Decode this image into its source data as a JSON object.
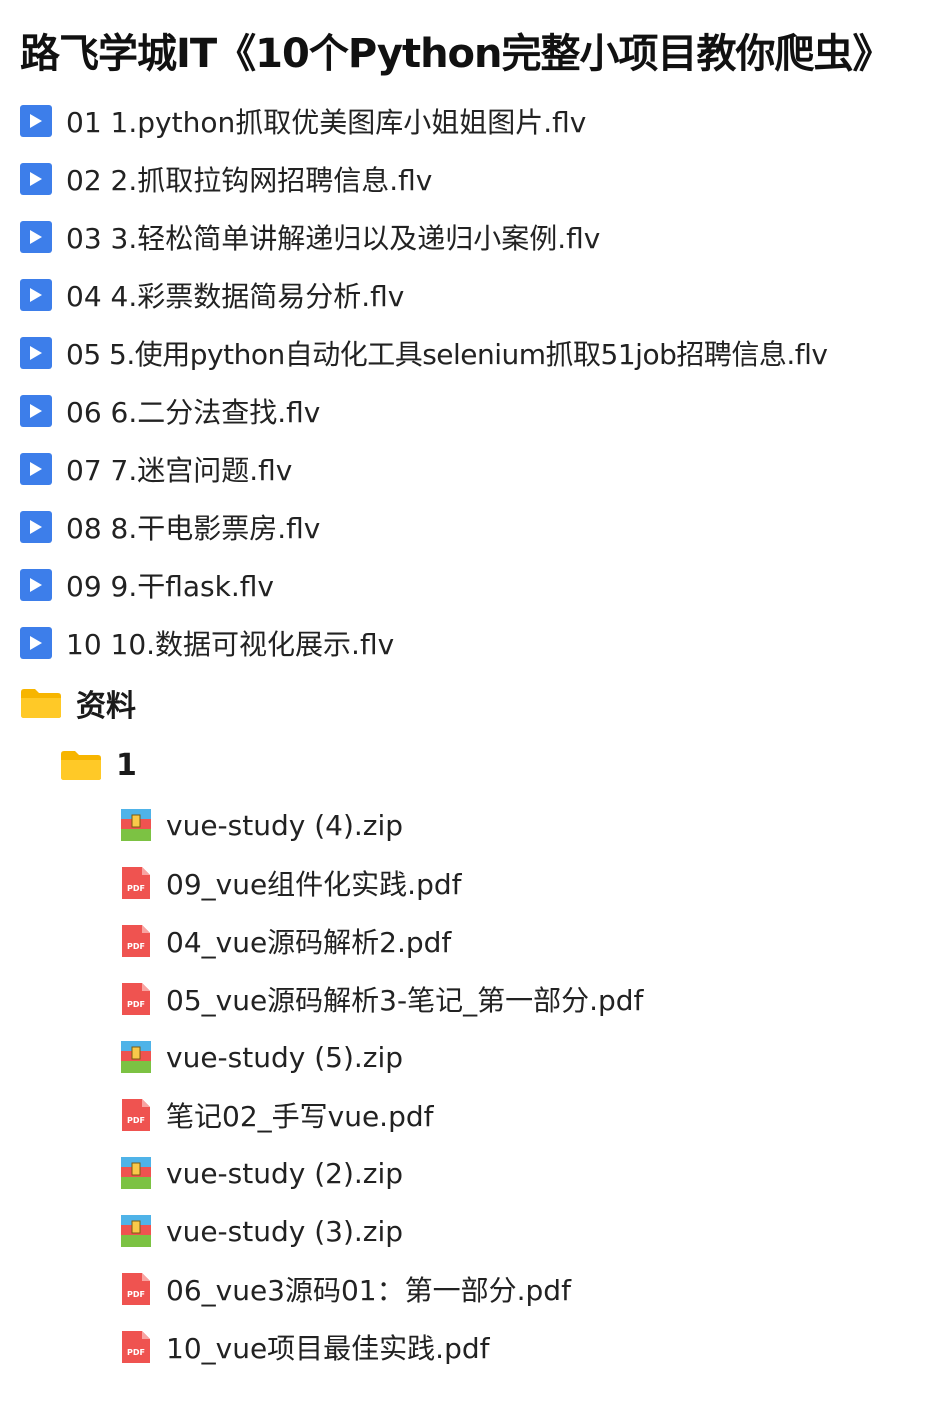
{
  "title": "路飞学城IT《10个Python完整小项目教你爬虫》",
  "videos": [
    {
      "label": "01 1.python抓取优美图库小姐姐图片.flv",
      "icon": "play-icon"
    },
    {
      "label": "02 2.抓取拉钩网招聘信息.flv",
      "icon": "play-icon"
    },
    {
      "label": "03 3.轻松简单讲解递归以及递归小案例.flv",
      "icon": "play-icon"
    },
    {
      "label": "04 4.彩票数据简易分析.flv",
      "icon": "play-icon"
    },
    {
      "label": "05 5.使用python自动化工具selenium抓取51job招聘信息.flv",
      "icon": "play-icon"
    },
    {
      "label": "06 6.二分法查找.flv",
      "icon": "play-icon"
    },
    {
      "label": "07 7.迷宫问题.flv",
      "icon": "play-icon"
    },
    {
      "label": "08 8.干电影票房.flv",
      "icon": "play-icon"
    },
    {
      "label": "09 9.干flask.flv",
      "icon": "play-icon"
    },
    {
      "label": "10 10.数据可视化展示.flv",
      "icon": "play-icon"
    }
  ],
  "folder": {
    "label": "资料",
    "icon": "folder-icon",
    "subfolder": {
      "label": "1",
      "icon": "folder-icon",
      "files": [
        {
          "label": "vue-study (4).zip",
          "icon": "zip-icon"
        },
        {
          "label": "09_vue组件化实践.pdf",
          "icon": "pdf-icon"
        },
        {
          "label": "04_vue源码解析2.pdf",
          "icon": "pdf-icon"
        },
        {
          "label": "05_vue源码解析3-笔记_第一部分.pdf",
          "icon": "pdf-icon"
        },
        {
          "label": "vue-study (5).zip",
          "icon": "zip-icon"
        },
        {
          "label": "笔记02_手写vue.pdf",
          "icon": "pdf-icon"
        },
        {
          "label": "vue-study (2).zip",
          "icon": "zip-icon"
        },
        {
          "label": "vue-study (3).zip",
          "icon": "zip-icon"
        },
        {
          "label": "06_vue3源码01：第一部分.pdf",
          "icon": "pdf-icon"
        },
        {
          "label": "10_vue项目最佳实践.pdf",
          "icon": "pdf-icon"
        }
      ]
    }
  },
  "colors": {
    "play": "#3d7eea",
    "folder": "#f7b500",
    "pdf": "#ef5350"
  }
}
